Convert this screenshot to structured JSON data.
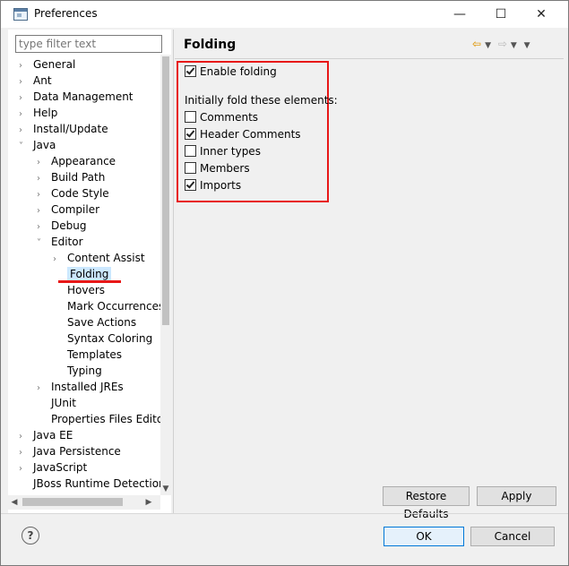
{
  "window": {
    "title": "Preferences",
    "minimize": "—",
    "maximize": "☐",
    "close": "✕"
  },
  "filter": {
    "placeholder": "type filter text"
  },
  "tree": [
    {
      "label": "General",
      "arrow": "›",
      "level": 0
    },
    {
      "label": "Ant",
      "arrow": "›",
      "level": 0
    },
    {
      "label": "Data Management",
      "arrow": "›",
      "level": 0
    },
    {
      "label": "Help",
      "arrow": "›",
      "level": 0
    },
    {
      "label": "Install/Update",
      "arrow": "›",
      "level": 0
    },
    {
      "label": "Java",
      "arrow": "˅",
      "level": 0
    },
    {
      "label": "Appearance",
      "arrow": "›",
      "level": 1
    },
    {
      "label": "Build Path",
      "arrow": "›",
      "level": 1
    },
    {
      "label": "Code Style",
      "arrow": "›",
      "level": 1
    },
    {
      "label": "Compiler",
      "arrow": "›",
      "level": 1
    },
    {
      "label": "Debug",
      "arrow": "›",
      "level": 1
    },
    {
      "label": "Editor",
      "arrow": "˅",
      "level": 1
    },
    {
      "label": "Content Assist",
      "arrow": "›",
      "level": 2
    },
    {
      "label": "Folding",
      "arrow": "",
      "level": 2,
      "selected": true
    },
    {
      "label": "Hovers",
      "arrow": "",
      "level": 2
    },
    {
      "label": "Mark Occurrences",
      "arrow": "",
      "level": 2
    },
    {
      "label": "Save Actions",
      "arrow": "",
      "level": 2
    },
    {
      "label": "Syntax Coloring",
      "arrow": "",
      "level": 2
    },
    {
      "label": "Templates",
      "arrow": "",
      "level": 2
    },
    {
      "label": "Typing",
      "arrow": "",
      "level": 2
    },
    {
      "label": "Installed JREs",
      "arrow": "›",
      "level": 1
    },
    {
      "label": "JUnit",
      "arrow": "",
      "level": 1
    },
    {
      "label": "Properties Files Editor",
      "arrow": "",
      "level": 1
    },
    {
      "label": "Java EE",
      "arrow": "›",
      "level": 0
    },
    {
      "label": "Java Persistence",
      "arrow": "›",
      "level": 0
    },
    {
      "label": "JavaScript",
      "arrow": "›",
      "level": 0
    },
    {
      "label": "JBoss Runtime Detection",
      "arrow": "",
      "level": 0
    }
  ],
  "page": {
    "title": "Folding",
    "nav_back": "⇦",
    "nav_forward": "⇨",
    "nav_dropdown": "▼",
    "view_menu": "▼",
    "enable_folding": "Enable folding",
    "enable_folding_checked": true,
    "section_label": "Initially fold these elements:",
    "options": [
      {
        "label": "Comments",
        "checked": false
      },
      {
        "label": "Header Comments",
        "checked": true
      },
      {
        "label": "Inner types",
        "checked": false
      },
      {
        "label": "Members",
        "checked": false
      },
      {
        "label": "Imports",
        "checked": true
      }
    ]
  },
  "buttons": {
    "restore_defaults": "Restore Defaults",
    "apply": "Apply",
    "ok": "OK",
    "cancel": "Cancel",
    "help": "?"
  },
  "colors": {
    "highlight_red": "#e81818",
    "selection": "#cce8ff",
    "default_button_border": "#0078d7"
  }
}
